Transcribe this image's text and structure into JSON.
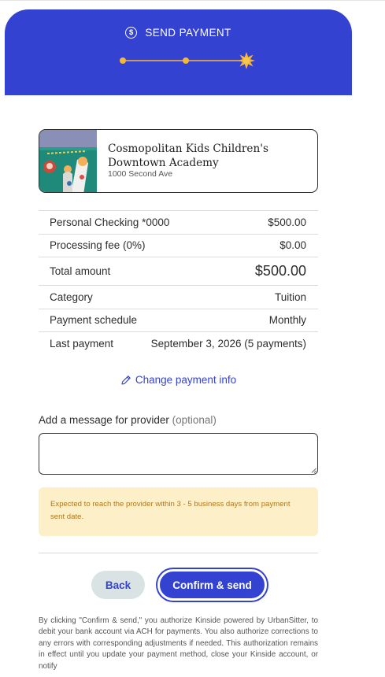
{
  "header": {
    "title": "SEND PAYMENT",
    "icon": "dollar-circle-icon",
    "background_color": "#3442d1",
    "step_color": "#f5b73b",
    "current_step": 3,
    "total_steps": 3
  },
  "provider": {
    "name": "Cosmopolitan Kids Children's Downtown Academy",
    "address": "1000 Second Ave",
    "image": "classroom-photo"
  },
  "summary": {
    "rows": [
      {
        "label": "Personal Checking *0000",
        "value": "$500.00"
      },
      {
        "label": "Processing fee (0%)",
        "value": "$0.00"
      },
      {
        "label": "Total amount",
        "value": "$500.00"
      },
      {
        "label": "Category",
        "value": "Tuition"
      },
      {
        "label": "Payment schedule",
        "value": "Monthly"
      },
      {
        "label": "Last payment",
        "value": "September 3, 2026 (5 payments)"
      }
    ]
  },
  "change_link": {
    "label": "Change payment info",
    "icon": "pencil-icon"
  },
  "message": {
    "label": "Add a message for provider",
    "optional": "(optional)",
    "value": "",
    "placeholder": ""
  },
  "notice": {
    "text": "Expected to reach the provider within 3 - 5 business days from payment sent date.",
    "background_color": "#fdf0c9",
    "text_color": "#b0771a"
  },
  "buttons": {
    "back": "Back",
    "confirm": "Confirm & send"
  },
  "legal_text": "By clicking \"Confirm & send,\" you authorize Kinside powered by UrbanSitter, to debit your bank account via ACH for payments. You also authorize corrections to any errors with corresponding adjustments if needed. This authorization remains in effect until you update your payment method, close your Kinside account, or notify"
}
